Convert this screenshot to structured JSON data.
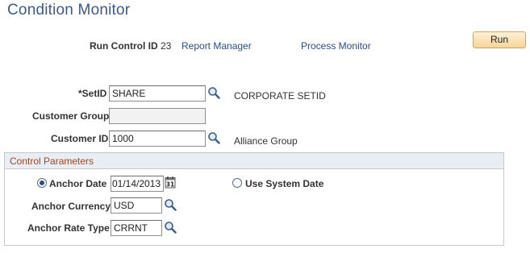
{
  "page": {
    "title": "Condition Monitor"
  },
  "header": {
    "run_control_label": "Run Control ID",
    "run_control_value": "23",
    "report_manager_link": "Report Manager",
    "process_monitor_link": "Process Monitor",
    "run_button": "Run"
  },
  "form": {
    "setid_label": "*SetID",
    "setid_value": "SHARE",
    "setid_description": "CORPORATE SETID",
    "customer_group_label": "Customer Group",
    "customer_group_value": "",
    "customer_id_label": "Customer ID",
    "customer_id_value": "1000",
    "customer_id_description": "Alliance Group"
  },
  "control_parameters": {
    "section_title": "Control Parameters",
    "anchor_date_label": "Anchor Date",
    "anchor_date_value": "01/14/2013",
    "anchor_date_selected": true,
    "use_system_date_label": "Use System Date",
    "use_system_date_selected": false,
    "anchor_currency_label": "Anchor Currency",
    "anchor_currency_value": "USD",
    "anchor_rate_type_label": "Anchor Rate Type",
    "anchor_rate_type_value": "CRRNT"
  },
  "icons": {
    "lookup": "magnifier-icon",
    "calendar": "calendar-icon"
  },
  "colors": {
    "title": "#3c5a8a",
    "link": "#2a4f8a",
    "section_title": "#a0451f",
    "run_button": "#f5d49a"
  }
}
